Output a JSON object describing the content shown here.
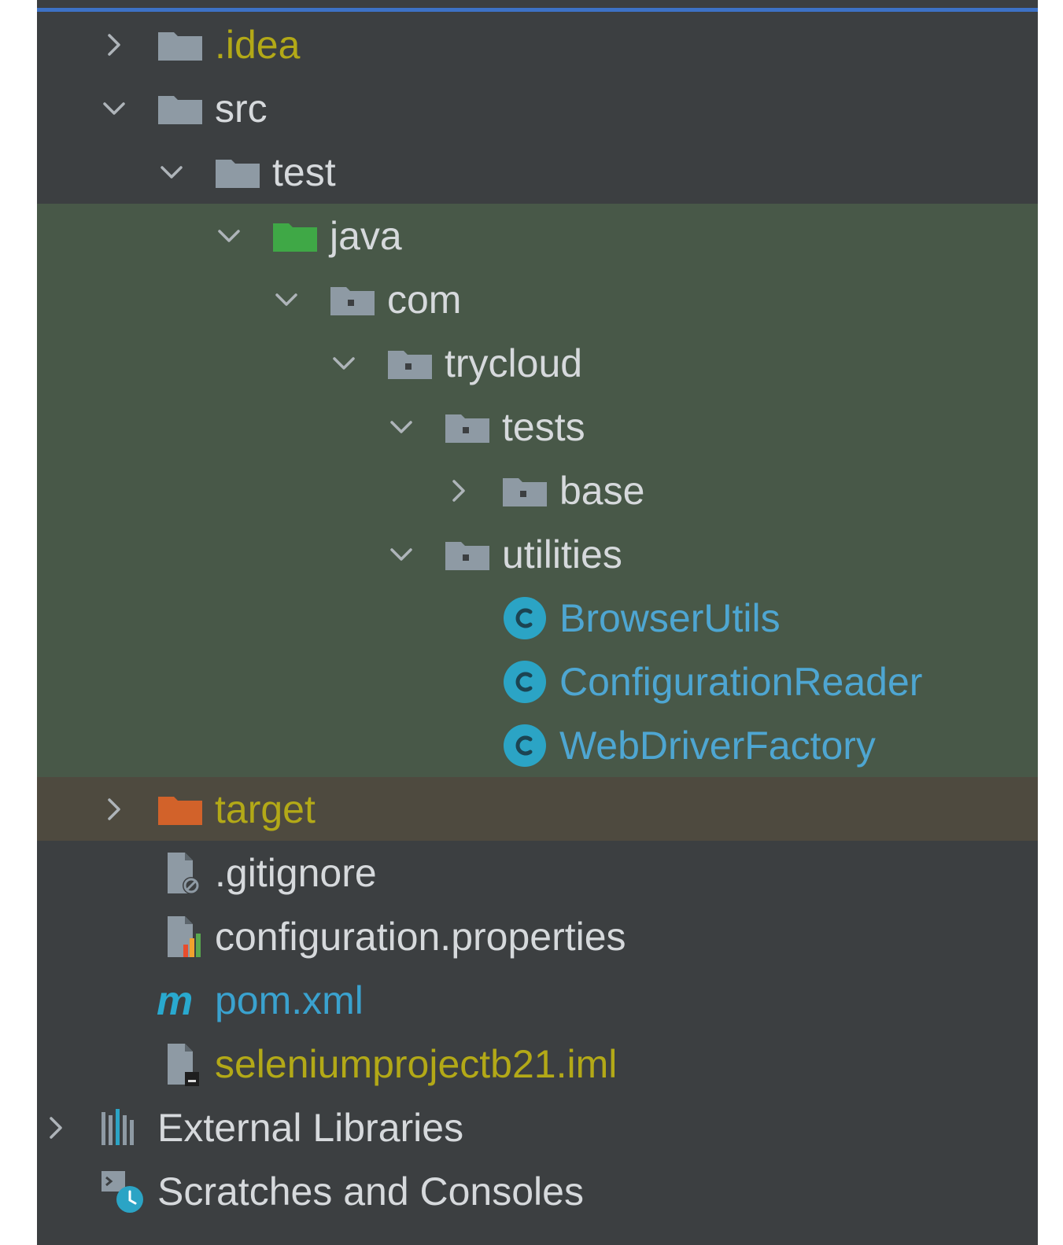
{
  "colors": {
    "panel_bg": "#3c3f41",
    "test_sources_bg": "#485848",
    "excluded_bg": "#4e4a3f",
    "accent_top": "#3d72c6",
    "text_default": "#d6d9dc",
    "text_ignored": "#b3a917",
    "text_modified": "#4ea6d2",
    "folder_gray": "#8e9aa4",
    "folder_test_root": "#3fa846",
    "folder_excluded": "#d2622a",
    "class_icon": "#2ba4c5"
  },
  "tree": [
    {
      "label": ".idea",
      "state": "collapsed",
      "icon": "folder-icon",
      "color": "yellow"
    },
    {
      "label": "src",
      "state": "expanded",
      "icon": "folder-icon",
      "color": "white"
    },
    {
      "label": "test",
      "state": "expanded",
      "icon": "folder-icon",
      "color": "white"
    },
    {
      "label": "java",
      "state": "expanded",
      "icon": "test-root-folder-icon",
      "color": "white"
    },
    {
      "label": "com",
      "state": "expanded",
      "icon": "package-icon",
      "color": "white"
    },
    {
      "label": "trycloud",
      "state": "expanded",
      "icon": "package-icon",
      "color": "white"
    },
    {
      "label": "tests",
      "state": "expanded",
      "icon": "package-icon",
      "color": "white"
    },
    {
      "label": "base",
      "state": "collapsed",
      "icon": "package-icon",
      "color": "white"
    },
    {
      "label": "utilities",
      "state": "expanded",
      "icon": "package-icon",
      "color": "white"
    },
    {
      "label": "BrowserUtils",
      "state": "leaf",
      "icon": "java-class-icon",
      "color": "blue"
    },
    {
      "label": "ConfigurationReader",
      "state": "leaf",
      "icon": "java-class-icon",
      "color": "blue"
    },
    {
      "label": "WebDriverFactory",
      "state": "leaf",
      "icon": "java-class-icon",
      "color": "blue"
    },
    {
      "label": "target",
      "state": "collapsed",
      "icon": "excluded-folder-icon",
      "color": "yellow"
    },
    {
      "label": ".gitignore",
      "state": "leaf",
      "icon": "gitignore-file-icon",
      "color": "white"
    },
    {
      "label": "configuration.properties",
      "state": "leaf",
      "icon": "properties-file-icon",
      "color": "white"
    },
    {
      "label": "pom.xml",
      "state": "leaf",
      "icon": "maven-icon",
      "color": "gitblue"
    },
    {
      "label": "seleniumprojectb21.iml",
      "state": "leaf",
      "icon": "iml-file-icon",
      "color": "yellow"
    },
    {
      "label": "External Libraries",
      "state": "collapsed",
      "icon": "libraries-icon",
      "color": "white"
    },
    {
      "label": "Scratches and Consoles",
      "state": "leaf",
      "icon": "scratches-icon",
      "color": "white"
    }
  ]
}
